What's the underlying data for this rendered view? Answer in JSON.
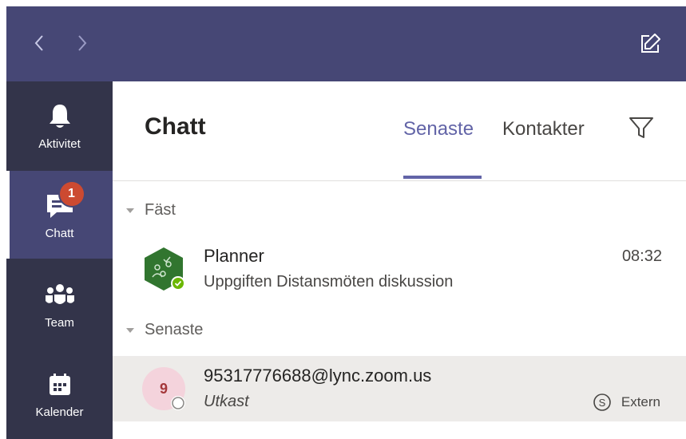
{
  "app": {
    "colors": {
      "title_bar": "#464775",
      "rail": "#33344a",
      "accent": "#6264a7",
      "badge": "#cc4a31",
      "planner_green": "#31752f",
      "selected_row": "#edebe9"
    }
  },
  "titlebar": {
    "back_icon": "chevron-left-icon",
    "forward_icon": "chevron-right-icon",
    "compose_icon": "compose-icon"
  },
  "rail": {
    "items": [
      {
        "label": "Aktivitet",
        "icon": "bell-icon"
      },
      {
        "label": "Chatt",
        "icon": "chat-icon",
        "badge": "1"
      },
      {
        "label": "Team",
        "icon": "team-icon"
      },
      {
        "label": "Kalender",
        "icon": "calendar-icon"
      }
    ]
  },
  "header": {
    "title": "Chatt",
    "tabs": [
      {
        "label": "Senaste",
        "active": true
      },
      {
        "label": "Kontakter",
        "active": false
      }
    ],
    "filter_icon": "filter-icon"
  },
  "sections": [
    {
      "label": "Fäst",
      "chats": [
        {
          "name": "Planner",
          "preview": "Uppgiften Distansmöten diskussion",
          "time": "08:32",
          "status": "available"
        }
      ]
    },
    {
      "label": "Senaste",
      "chats": [
        {
          "name": "95317776688@lync.zoom.us",
          "preview": "Utkast",
          "avatar_initial": "9",
          "tag": "Extern",
          "tag_icon": "skype-icon",
          "status": "unknown"
        }
      ]
    }
  ]
}
